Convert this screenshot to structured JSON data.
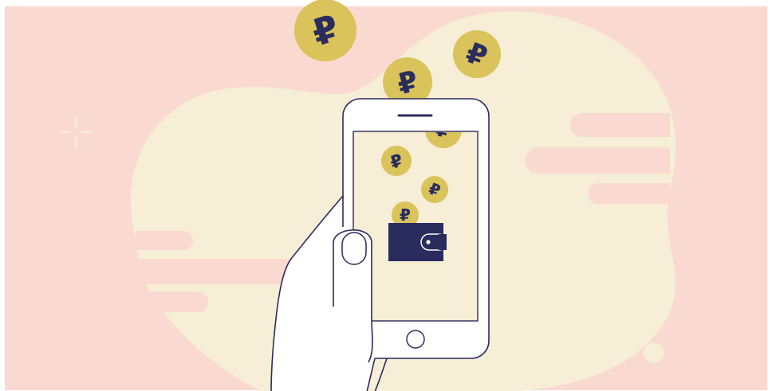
{
  "colors": {
    "background": "#fad9d0",
    "blob": "#f6eed7",
    "coin": "#d9c35a",
    "ink": "#2a2c5e",
    "white": "#ffffff"
  },
  "symbols": {
    "currency": "₽"
  },
  "icons": {
    "wallet": "wallet-icon",
    "coin": "ruble-coin-icon",
    "sparkle": "sparkle-icon"
  }
}
